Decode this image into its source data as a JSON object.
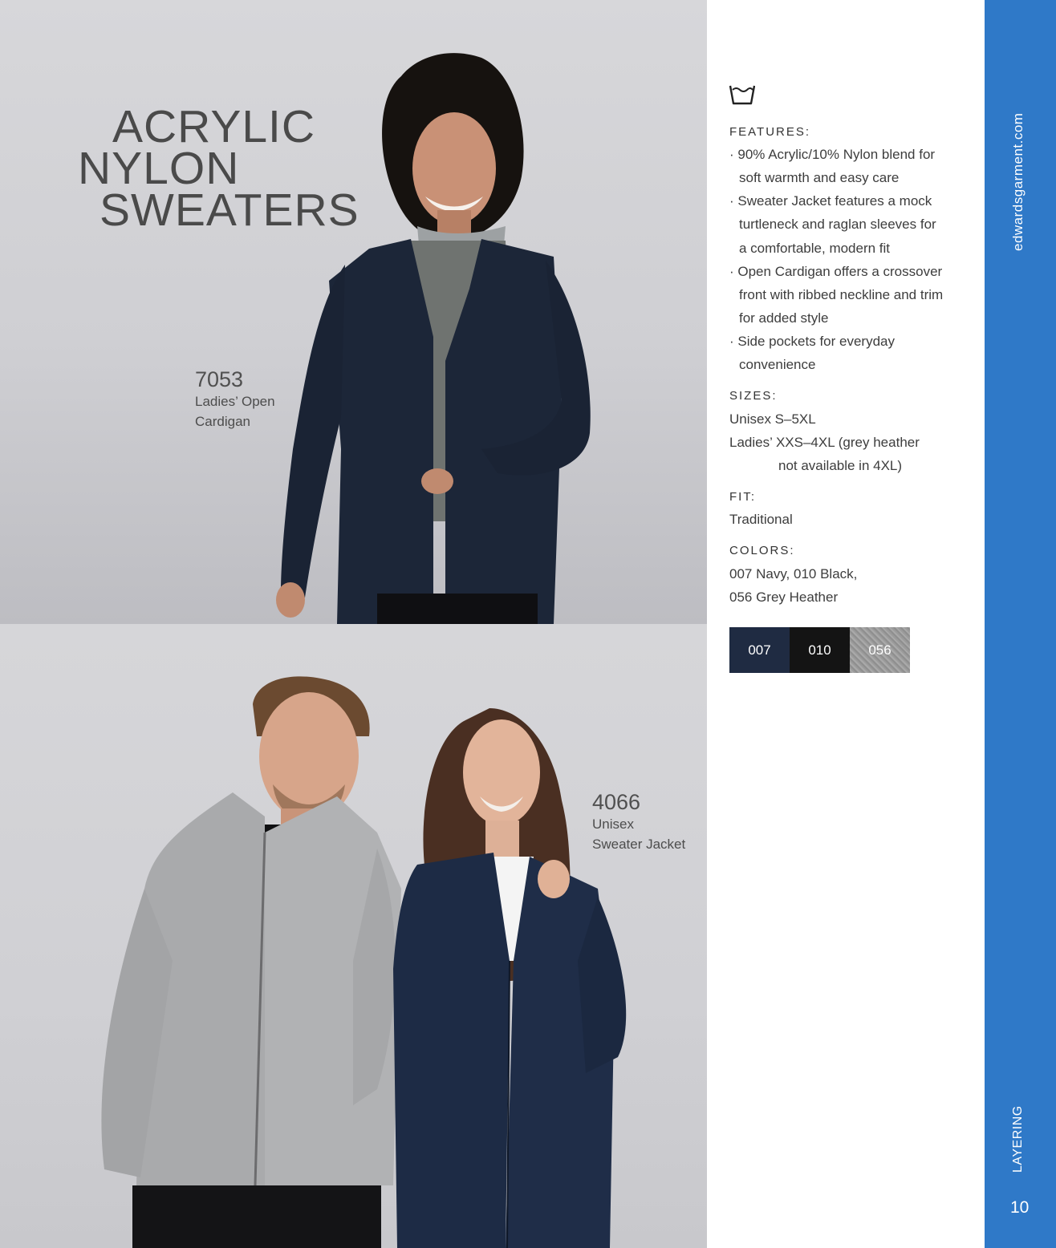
{
  "title": {
    "line1": "ACRYLIC",
    "line2": "NYLON",
    "line3": "SWEATERS"
  },
  "products": [
    {
      "number": "7053",
      "name_line1": "Ladies’ Open",
      "name_line2": "Cardigan"
    },
    {
      "number": "4066",
      "name_line1": "Unisex",
      "name_line2": "Sweater Jacket"
    }
  ],
  "icons": {
    "care": "wash-tub-icon"
  },
  "features": {
    "label": "FEATURES:",
    "lines": [
      "· 90% Acrylic/10% Nylon blend for",
      "soft warmth and easy care",
      "· Sweater Jacket features a mock",
      "turtleneck and raglan sleeves for",
      "a comfortable, modern fit",
      "· Open Cardigan offers a crossover",
      "front with ribbed neckline and trim",
      "for added style",
      "· Side pockets for everyday",
      "convenience"
    ]
  },
  "sizes": {
    "label": "SIZES:",
    "lines": [
      "Unisex S–5XL",
      "Ladies’ XXS–4XL (grey heather",
      "not available in 4XL)"
    ]
  },
  "fit": {
    "label": "FIT:",
    "value": "Traditional"
  },
  "colors": {
    "label": "COLORS:",
    "lines": [
      "007 Navy, 010 Black,",
      "056 Grey Heather"
    ],
    "swatches": [
      {
        "code": "007",
        "color": "#1f2b42"
      },
      {
        "code": "010",
        "color": "#141414"
      },
      {
        "code": "056",
        "color": "#9b9b9b"
      }
    ]
  },
  "sidebar": {
    "url": "edwardsgarment.com",
    "section": "LAYERING",
    "page_number": "10",
    "color": "#2f79c8"
  }
}
